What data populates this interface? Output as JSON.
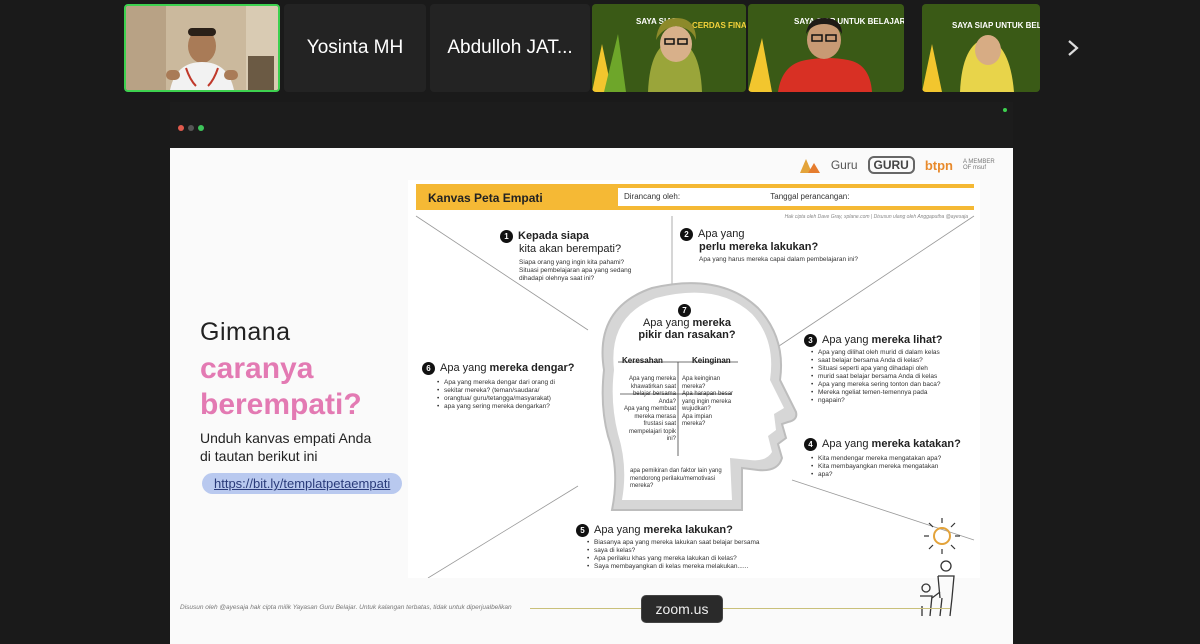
{
  "participants": {
    "tile2_name": "Yosinta MH",
    "tile3_name": "Abdulloh JAT...",
    "video_banner_1": "SAYA SIAP UNTUK BELAJAR JADI GURU KREATIF CERDAS FINANSIAL",
    "video_banner_short": "SAYA SIAP UNTUK BELAJAR"
  },
  "slide": {
    "logos": [
      "Guru",
      "GURU",
      "btpn",
      "A MEMBER OF msuf"
    ],
    "gimana": "Gimana",
    "caranya_line1": "caranya",
    "caranya_line2": "berempati?",
    "unduh_line1": "Unduh kanvas empati Anda",
    "unduh_line2": "di tautan berikut ini",
    "link": "https://bit.ly/templatpetaempati",
    "footnote": "Disusun oleh @ayesaja hak cipta milik Yayasan Guru Belajar. Untuk kalangan terbatas, tidak untuk diperjualbelikan"
  },
  "canvas": {
    "title": "Kanvas Peta Empati",
    "field1": "Dirancang oleh:",
    "field2": "Tanggal perancangan:",
    "credit": "Hak cipta oleh Dave Gray, xplane.com | Disusun ulang oleh Anggaputha @ayesaja",
    "q1_num": "1",
    "q1_a": "Kepada siapa",
    "q1_b": "kita akan berempati?",
    "q1_sub1": "Siapa orang yang ingin kita pahami?",
    "q1_sub2": "Situasi pembelajaran apa yang sedang",
    "q1_sub3": "dihadapi olehnya saat ini?",
    "q2_num": "2",
    "q2_a": "Apa yang",
    "q2_b": "perlu mereka lakukan?",
    "q2_sub": "Apa yang harus mereka capai dalam pembelajaran ini?",
    "q3_num": "3",
    "q3_a": "Apa yang ",
    "q3_b": "mereka lihat?",
    "q3_items": [
      "Apa yang dilihat oleh murid di dalam kelas",
      "saat belajar bersama Anda di kelas?",
      "Situasi seperti apa yang dihadapi oleh",
      "murid saat belajar bersama Anda di kelas",
      "Apa yang mereka sering tonton dan baca?",
      "Mereka ngeliat temen-temennya pada",
      "ngapain?"
    ],
    "q4_num": "4",
    "q4_a": "Apa yang ",
    "q4_b": "mereka katakan?",
    "q4_items": [
      "Kita mendengar mereka mengatakan apa?",
      "Kita membayangkan mereka mengatakan",
      "apa?"
    ],
    "q5_num": "5",
    "q5_a": "Apa yang ",
    "q5_b": "mereka lakukan?",
    "q5_items": [
      "Biasanya apa yang mereka lakukan saat belajar bersama",
      "saya di kelas?",
      "Apa perilaku khas yang mereka lakukan di kelas?",
      "Saya membayangkan di kelas mereka melakukan......"
    ],
    "q6_num": "6",
    "q6_a": "Apa yang ",
    "q6_b": "mereka dengar?",
    "q6_items": [
      "Apa yang mereka dengar dari orang di",
      "sekitar mereka? (teman/saudara/",
      "orangtua/ guru/tetangga/masyarakat)",
      "apa yang sering mereka dengarkan?"
    ],
    "q7_num": "7",
    "q7_a": "Apa yang ",
    "q7_b": "mereka",
    "q7_c": "pikir dan rasakan?",
    "keresahan": "Keresahan",
    "keinginan": "Keinginan",
    "kere_lines": [
      "Apa yang mereka",
      "khawatirkan saat",
      "belajar bersama",
      "Anda?",
      "Apa yang membuat",
      "mereka merasa",
      "frustasi saat",
      "mempelajari topik",
      "ini?"
    ],
    "kein_lines": [
      "Apa keinginan",
      "mereka?",
      "Apa harapan besar",
      "yang ingin mereka",
      "wujudkan?",
      "Apa impian",
      "mereka?"
    ],
    "pemikiran_lines": [
      "apa pemikiran dan faktor lain yang",
      "mendorong perilaku/memotivasi",
      "mereka?"
    ]
  },
  "zoom_badge": "zoom.us",
  "colors": {
    "accent_pink": "#e37ab3",
    "header_yellow": "#f5b935",
    "active_green": "#3dd14f"
  },
  "icons": [
    "chevron-right-icon",
    "sun-icon",
    "parent-child-icon"
  ]
}
